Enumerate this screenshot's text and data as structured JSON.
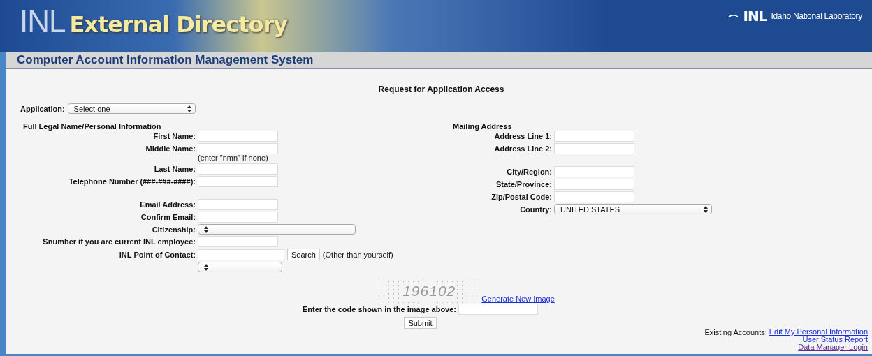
{
  "header": {
    "logo_prefix": "INL",
    "logo_title": "External Directory",
    "org_mark": "INL",
    "org_name": "Idaho National Laboratory"
  },
  "system_bar": {
    "title": "Computer Account Information Management System"
  },
  "form": {
    "title": "Request for Application Access",
    "application": {
      "label": "Application:",
      "value": "Select one"
    },
    "left": {
      "heading": "Full Legal Name/Personal Information",
      "groups": [
        [
          {
            "kind": "text",
            "label": "First Name:"
          },
          {
            "kind": "text",
            "label": "Middle Name:"
          },
          {
            "kind": "note",
            "text": "(enter \"nmn\" if none)"
          },
          {
            "kind": "text",
            "label": "Last Name:"
          },
          {
            "kind": "text",
            "label": "Telephone Number (###-###-####):"
          }
        ],
        [
          {
            "kind": "text",
            "label": "Email Address:"
          },
          {
            "kind": "text",
            "label": "Confirm Email:"
          },
          {
            "kind": "select",
            "label": "Citizenship:"
          },
          {
            "kind": "text",
            "label": "Snumber if you are current INL employee:"
          },
          {
            "kind": "search",
            "label": "INL Point of Contact:",
            "button": "Search",
            "note": "(Other than yourself)"
          },
          {
            "kind": "select"
          }
        ]
      ]
    },
    "right": {
      "heading": "Mailing Address",
      "groups": [
        [
          {
            "kind": "text",
            "label": "Address Line 1:"
          },
          {
            "kind": "text",
            "label": "Address Line 2:"
          }
        ],
        [
          {
            "kind": "text",
            "label": "City/Region:"
          },
          {
            "kind": "text",
            "label": "State/Province:"
          },
          {
            "kind": "text",
            "label": "Zip/Postal Code:"
          },
          {
            "kind": "select",
            "label": "Country:",
            "value": "UNITED STATES"
          }
        ]
      ]
    },
    "captcha": {
      "code": "196102",
      "link": "Generate New Image",
      "label": "Enter the code shown in the image above:"
    },
    "submit": "Submit"
  },
  "existing_accounts": {
    "label": "Existing Accounts:",
    "links": [
      {
        "text": "Edit My Personal Information",
        "visited": false
      },
      {
        "text": "User Status Report",
        "visited": false
      },
      {
        "text": "Data Manager Login",
        "visited": true
      }
    ]
  }
}
